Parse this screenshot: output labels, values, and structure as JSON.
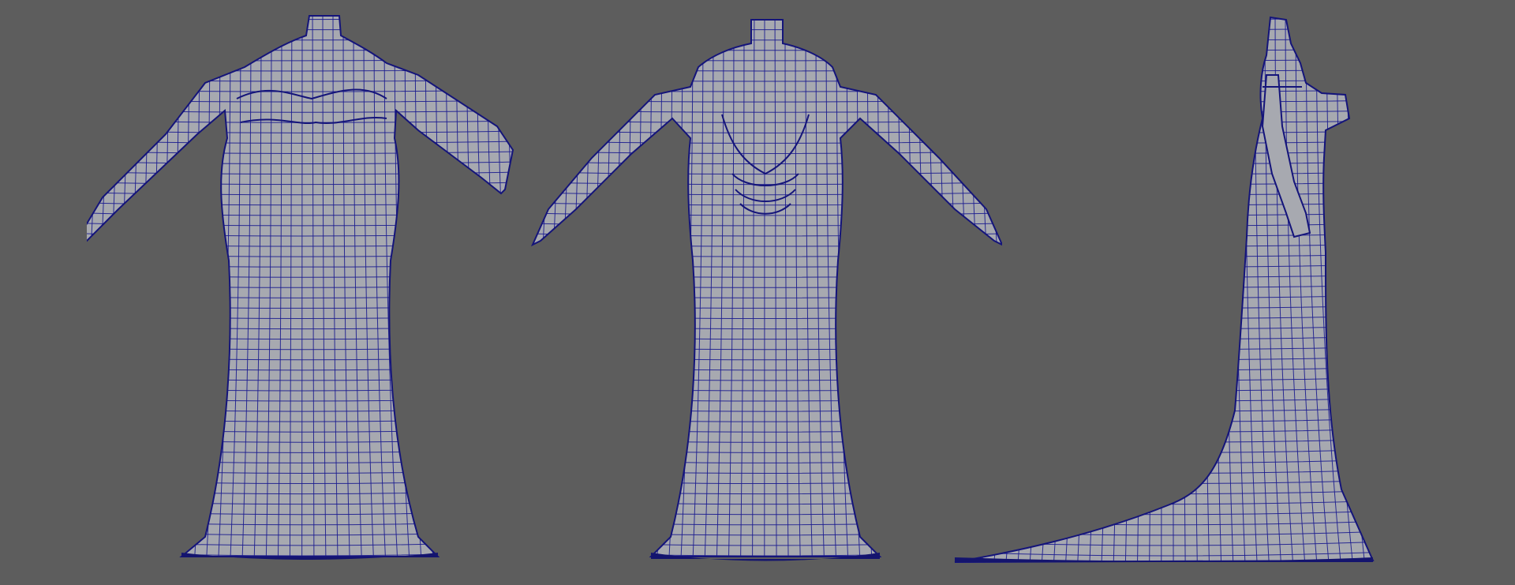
{
  "viewport": {
    "background_color": "#5d5d5d",
    "mesh_fill_color": "#a7a9b0",
    "wireframe_color": "#1c1c8f"
  },
  "views": [
    {
      "icon": "gown-front-view"
    },
    {
      "icon": "gown-back-view"
    },
    {
      "icon": "gown-side-view"
    }
  ]
}
